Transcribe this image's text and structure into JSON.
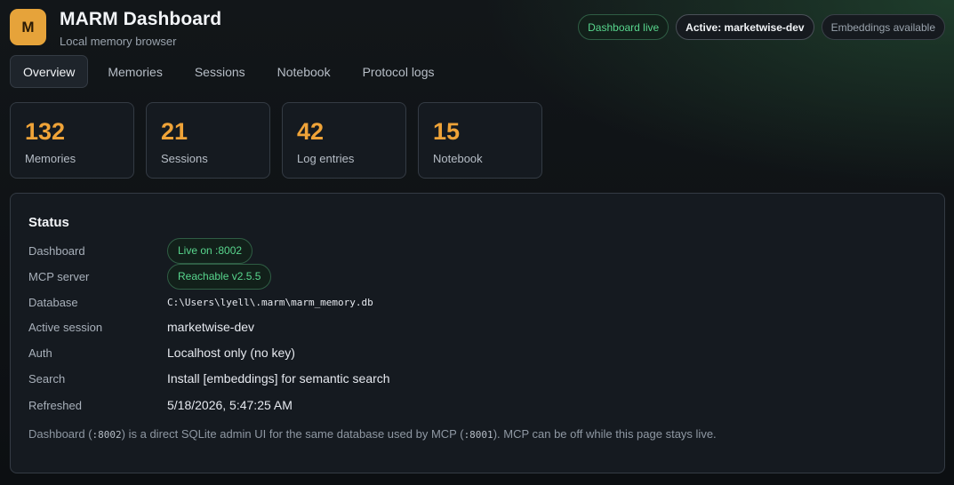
{
  "header": {
    "logo_letter": "M",
    "title": "MARM Dashboard",
    "subtitle": "Local memory browser",
    "pills": {
      "live": "Dashboard live",
      "active": "Active: marketwise-dev",
      "embeddings": "Embeddings available"
    }
  },
  "tabs": [
    "Overview",
    "Memories",
    "Sessions",
    "Notebook",
    "Protocol logs"
  ],
  "active_tab": "Overview",
  "stats": [
    {
      "value": "132",
      "label": "Memories"
    },
    {
      "value": "21",
      "label": "Sessions"
    },
    {
      "value": "42",
      "label": "Log entries"
    },
    {
      "value": "15",
      "label": "Notebook"
    }
  ],
  "status": {
    "title": "Status",
    "rows": [
      {
        "label": "Dashboard",
        "value": "Live on :8002"
      },
      {
        "label": "MCP server",
        "value": "Reachable v2.5.5"
      },
      {
        "label": "Database",
        "value": "C:\\Users\\lyell\\.marm\\marm_memory.db"
      },
      {
        "label": "Active session",
        "value": "marketwise-dev"
      },
      {
        "label": "Auth",
        "value": "Localhost only (no key)"
      },
      {
        "label": "Search",
        "value": "Install [embeddings] for semantic search"
      },
      {
        "label": "Refreshed",
        "value": "5/18/2026, 5:47:25 AM"
      }
    ],
    "note": {
      "part1": "Dashboard (",
      "code1": ":8002",
      "part2": ") is a direct SQLite admin UI for the same database used by MCP (",
      "code2": ":8001",
      "part3": "). MCP can be off while this page stays live."
    }
  },
  "colors": {
    "accent": "#efa338",
    "live_green": "#58d68d",
    "logo_bg": "#e6a33a"
  }
}
